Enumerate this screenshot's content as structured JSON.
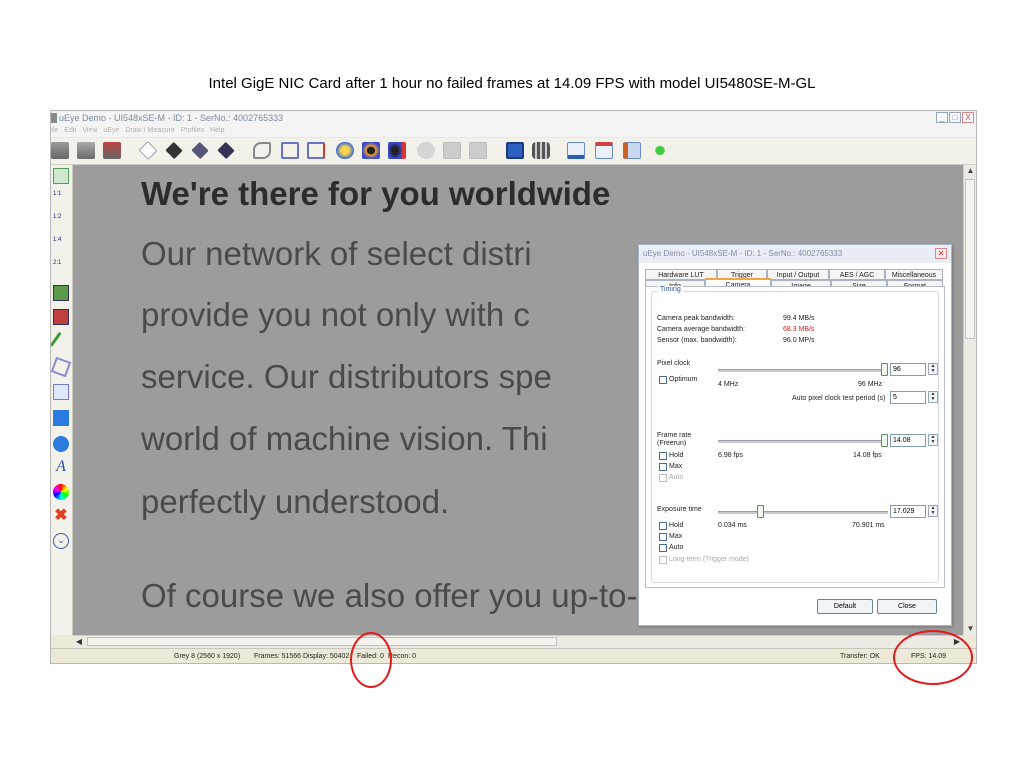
{
  "slide": {
    "title": "Intel GigE NIC Card after 1 hour no failed frames at 14.09 FPS with model UI5480SE-M-GL"
  },
  "window": {
    "title": "uEye Demo - UI548xSE-M - ID: 1 - SerNo.: 4002765333",
    "menu": [
      "File",
      "Edit",
      "View",
      "uEye",
      "Draw / Measure",
      "Profiles",
      "Help"
    ],
    "controls": [
      "_",
      "□",
      "X"
    ]
  },
  "toolbar": {
    "icons": [
      "camera-open-icon",
      "camera-live-icon",
      "camera-close-icon",
      "diamond-1-icon",
      "diamond-2-icon",
      "diamond-3-icon",
      "diamond-4-icon",
      "wrench-icon",
      "roi-rect-icon",
      "roi-delete-icon",
      "cpu-icon",
      "record-icon",
      "record-stop-icon",
      "disabled-1-icon",
      "disabled-2-icon",
      "disabled-3-icon",
      "save-icon",
      "film-icon",
      "histogram-icon",
      "line-view-icon",
      "image-info-icon",
      "magic-wand-icon"
    ]
  },
  "left_toolbar": {
    "labels": [
      "1:1",
      "1:2",
      "1:4",
      "2:1"
    ]
  },
  "image_text": {
    "heading": "We're there for you worldwide",
    "lines": [
      "Our network of select distri",
      "provide you not only with c",
      "service. Our distributors spe",
      "world of machine vision. Thi",
      "perfectly understood.",
      "Of course we also offer you up-to-date interf"
    ]
  },
  "statusbar": {
    "format": "Grey 8 (2560 x 1920)",
    "frames": "Frames: 51566",
    "display": "Display: 50402",
    "failed": "Failed: 0",
    "recon": "Recon: 0",
    "transfer": "Transfer: OK",
    "fps": "FPS: 14.09"
  },
  "dialog": {
    "title": "uEye Demo - UI548xSE-M - ID: 1 - SerNo.: 4002765333",
    "tabs_row1": [
      "Hardware LUT",
      "Trigger",
      "Input / Output",
      "AES / AGC",
      "Miscellaneous"
    ],
    "tabs_row2": [
      "Info",
      "Camera",
      "Image",
      "Size",
      "Format"
    ],
    "active_tab": "Camera",
    "group_title": "Timing",
    "bandwidth": {
      "peak_label": "Camera peak bandwidth:",
      "peak_value": "99.4 MB/s",
      "avg_label": "Camera average bandwidth:",
      "avg_value": "68.3 MB/s",
      "sensor_label": "Sensor (max. bandwidth):",
      "sensor_value": "96.0 MP/s"
    },
    "pixel_clock": {
      "label": "Pixel clock",
      "optimum_label": "Optimum",
      "min_label": "4 MHz",
      "max_label": "96 MHz",
      "value": "96",
      "auto_test_label": "Auto pixel clock test period (s)",
      "auto_test_value": "5",
      "level": 1.0
    },
    "frame_rate": {
      "label": "Frame rate (Freerun)",
      "hold_label": "Hold",
      "max_label": "Max",
      "auto_label": "Auto",
      "min_text": "6.98 fps",
      "max_text": "14.08 fps",
      "value": "14.08",
      "level": 1.0
    },
    "exposure": {
      "label": "Exposure time",
      "hold_label": "Hold",
      "max_label": "Max",
      "auto_label": "Auto",
      "longterm_label": "Long-term (Trigger mode)",
      "min_text": "0.034 ms",
      "max_text": "70.901 ms",
      "value": "17.029",
      "level": 0.24
    },
    "default_button": "Default",
    "close_button": "Close"
  },
  "colors": {
    "highlight_circle": "#e31b1b",
    "active_tab_accent": "#f3a43b",
    "avg_bandwidth": "#d82020"
  }
}
